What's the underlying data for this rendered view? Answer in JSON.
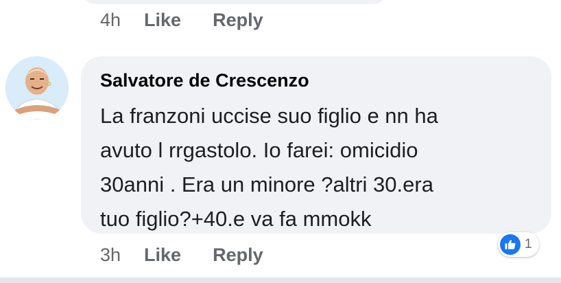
{
  "previous_comment": {
    "time": "4h",
    "like_label": "Like",
    "reply_label": "Reply"
  },
  "comment": {
    "author": "Salvatore de Crescenzo",
    "lines": [
      "La franzoni uccise suo figlio e nn ha",
      "avuto l rrgastolo. Io farei: omicidio",
      "30anni . Era un minore ?altri 30.era",
      "tuo figlio?+40.e va fa mmokk"
    ],
    "time": "3h",
    "like_label": "Like",
    "reply_label": "Reply",
    "reaction_icon": "thumbs-up-icon",
    "reaction_count": "1"
  },
  "colors": {
    "bubble": "#f0f2f5",
    "meta_text": "#65676b",
    "like_blue": "#1877f2"
  }
}
